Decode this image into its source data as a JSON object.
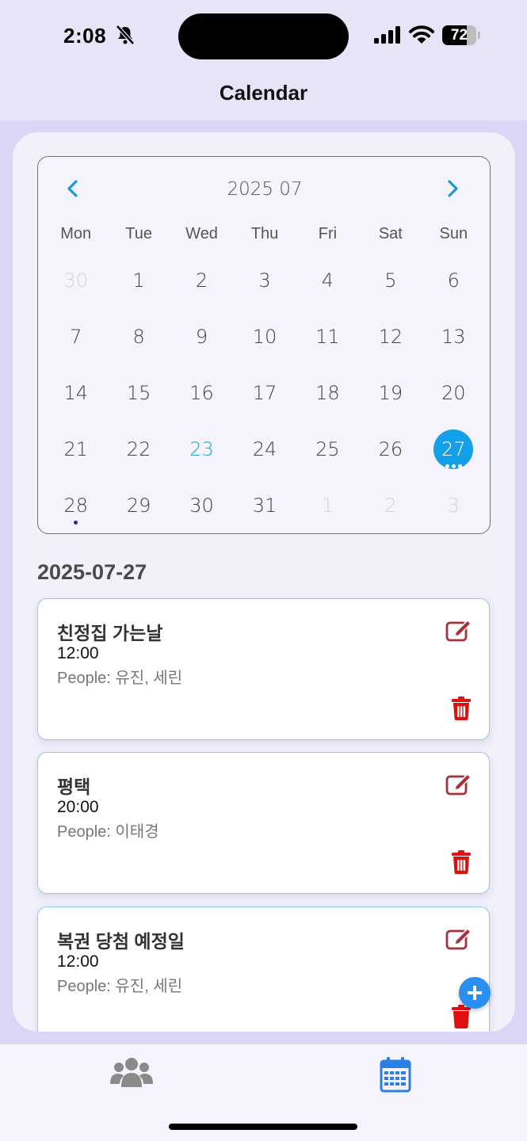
{
  "status_bar": {
    "time": "2:08",
    "battery_percent": "72",
    "battery_level": 0.72,
    "icons": [
      "bell-slash-icon",
      "signal-icon",
      "wifi-icon",
      "battery-icon"
    ]
  },
  "header": {
    "title": "Calendar"
  },
  "calendar": {
    "month_title": "2025 07",
    "prev_icon": "chevron-left-icon",
    "next_icon": "chevron-right-icon",
    "weekdays": [
      "Mon",
      "Tue",
      "Wed",
      "Thu",
      "Fri",
      "Sat",
      "Sun"
    ],
    "days": [
      {
        "label": "30",
        "state": "other"
      },
      {
        "label": "1"
      },
      {
        "label": "2"
      },
      {
        "label": "3"
      },
      {
        "label": "4"
      },
      {
        "label": "5"
      },
      {
        "label": "6"
      },
      {
        "label": "7"
      },
      {
        "label": "8"
      },
      {
        "label": "9"
      },
      {
        "label": "10"
      },
      {
        "label": "11"
      },
      {
        "label": "12"
      },
      {
        "label": "13"
      },
      {
        "label": "14"
      },
      {
        "label": "15"
      },
      {
        "label": "16"
      },
      {
        "label": "17"
      },
      {
        "label": "18"
      },
      {
        "label": "19"
      },
      {
        "label": "20"
      },
      {
        "label": "21"
      },
      {
        "label": "22"
      },
      {
        "label": "23",
        "state": "today"
      },
      {
        "label": "24"
      },
      {
        "label": "25"
      },
      {
        "label": "26"
      },
      {
        "label": "27",
        "state": "selected",
        "dots": 3
      },
      {
        "label": "28",
        "dots": 1
      },
      {
        "label": "29"
      },
      {
        "label": "30"
      },
      {
        "label": "31"
      },
      {
        "label": "1",
        "state": "other"
      },
      {
        "label": "2",
        "state": "other"
      },
      {
        "label": "3",
        "state": "other"
      }
    ],
    "colors": {
      "selected": "#14a0e8",
      "today": "#2aa3d8",
      "dot": "#1a23c6"
    }
  },
  "selected_date": "2025-07-27",
  "events": [
    {
      "title": "친정집 가는날",
      "time": "12:00",
      "people": "People: 유진, 세린"
    },
    {
      "title": "평택",
      "time": "20:00",
      "people": "People: 이태경"
    },
    {
      "title": "복권 당첨 예정일",
      "time": "12:00",
      "people": "People: 유진, 세린"
    }
  ],
  "actions": {
    "edit_icon": "edit-icon",
    "delete_icon": "trash-icon",
    "add_icon": "plus-icon"
  },
  "bottom_nav": {
    "items": [
      {
        "icon": "users-icon",
        "active": false
      },
      {
        "icon": "calendar-icon",
        "active": true
      }
    ],
    "colors": {
      "active": "#2a7ee8",
      "inactive": "#8a8a8a"
    }
  }
}
